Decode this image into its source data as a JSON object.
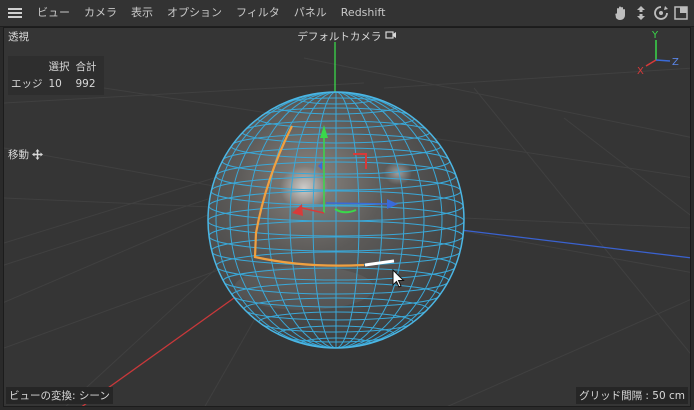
{
  "menubar": {
    "items": [
      {
        "id": "view",
        "label": "ビュー"
      },
      {
        "id": "camera",
        "label": "カメラ"
      },
      {
        "id": "display",
        "label": "表示"
      },
      {
        "id": "options",
        "label": "オプション"
      },
      {
        "id": "filter",
        "label": "フィルタ"
      },
      {
        "id": "panel",
        "label": "パネル"
      },
      {
        "id": "redshift",
        "label": "Redshift"
      }
    ],
    "nav_icons": [
      "hand-pan-icon",
      "move-camera-icon",
      "rotate-camera-icon",
      "maximize-view-icon"
    ]
  },
  "viewport": {
    "view_name": "透視",
    "camera_label": "デフォルトカメラ",
    "camera_icon": "camera-link-icon",
    "stats": {
      "headers": [
        "選択",
        "合計"
      ],
      "row_label": "エッジ",
      "selected": "10",
      "total": "992"
    },
    "tool_label": "移動",
    "tool_icon": "move-tool-icon",
    "transform_label": "ビューの変換: シーン",
    "grid_label": "グリッド間隔 : 50 cm",
    "axis_labels": {
      "y": "Y",
      "x": "X",
      "z": "Z"
    }
  },
  "colors": {
    "background": "#353535",
    "wireframe": "#3aa8d8",
    "selection": "#f0a040",
    "highlight": "#ffffff",
    "axis_x": "#d83a3a",
    "axis_y": "#3ad84a",
    "axis_z": "#3a6ad8"
  }
}
